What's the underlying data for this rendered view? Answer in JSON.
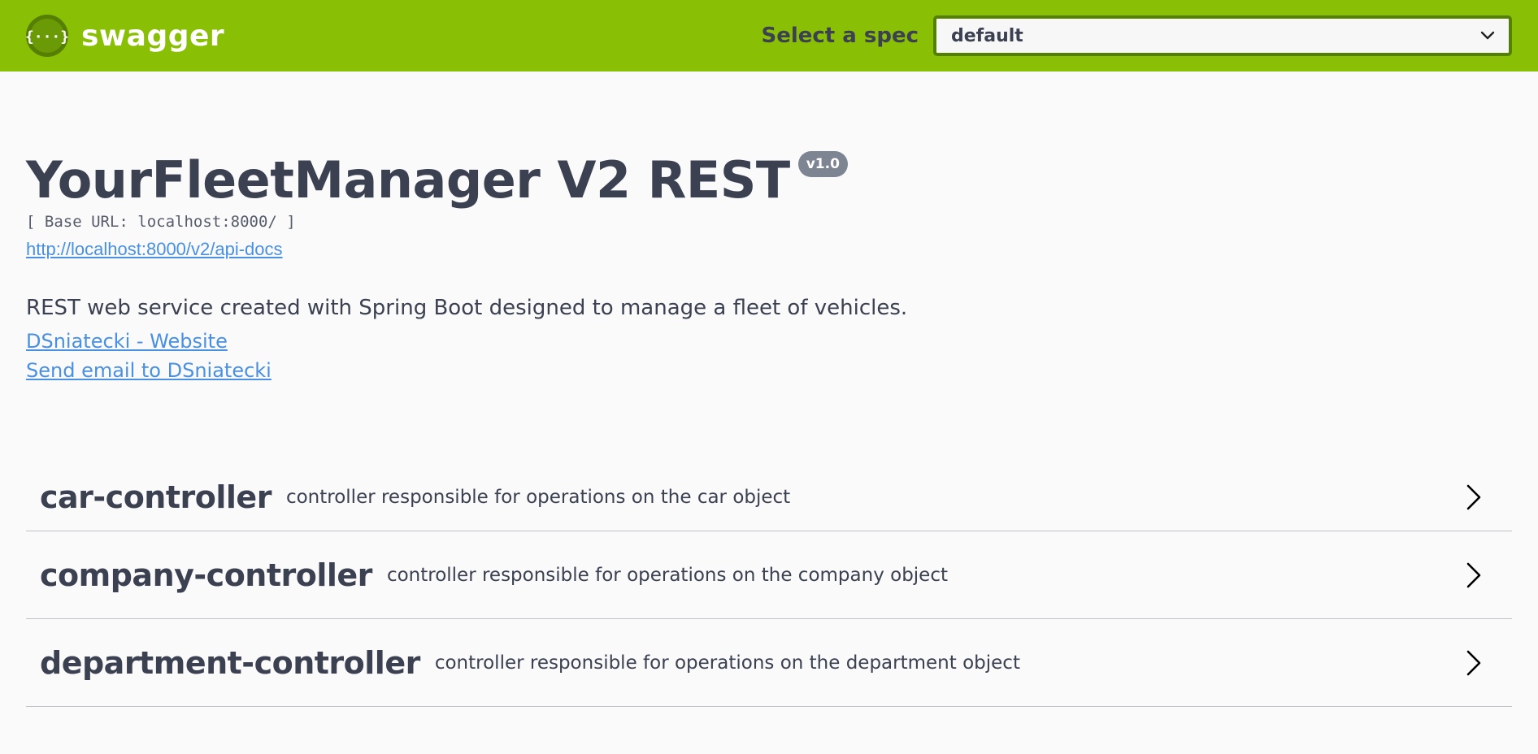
{
  "topbar": {
    "brand": "swagger",
    "spec_label": "Select a spec",
    "spec_value": "default",
    "colors": {
      "background": "#89bf04",
      "accent_dark": "#547f00"
    }
  },
  "info": {
    "title": "YourFleetManager V2 REST",
    "version": "v1.0",
    "base_url": "[ Base URL: localhost:8000/ ]",
    "api_docs_link": "http://localhost:8000/v2/api-docs",
    "description": "REST web service created with Spring Boot designed to manage a fleet of vehicles.",
    "contact_links": [
      "DSniatecki - Website",
      "Send email to DSniatecki"
    ]
  },
  "tags": [
    {
      "name": "car-controller",
      "description": "controller responsible for operations on the car object"
    },
    {
      "name": "company-controller",
      "description": "controller responsible for operations on the company object"
    },
    {
      "name": "department-controller",
      "description": "controller responsible for operations on the department object"
    }
  ],
  "icons": {
    "logo": "swagger-logo-icon",
    "select_caret": "chevron-down-icon",
    "expand": "chevron-right-icon"
  }
}
